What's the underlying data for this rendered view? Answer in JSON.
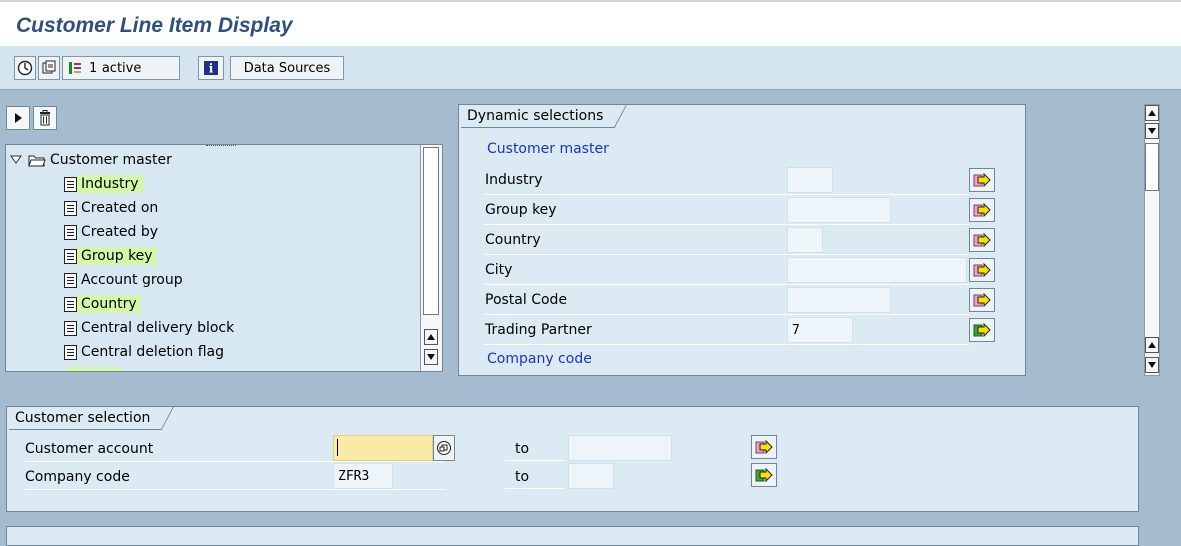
{
  "window": {
    "title": "Customer Line Item Display"
  },
  "toolbar": {
    "active_count": "1",
    "active_label": "active",
    "data_sources": "Data Sources"
  },
  "tree": {
    "root": "Customer master",
    "items": [
      {
        "label": "Industry",
        "highlight": true
      },
      {
        "label": "Created on",
        "highlight": false
      },
      {
        "label": "Created by",
        "highlight": false
      },
      {
        "label": "Group key",
        "highlight": true
      },
      {
        "label": "Account group",
        "highlight": false
      },
      {
        "label": "Country",
        "highlight": true
      },
      {
        "label": "Central delivery block",
        "highlight": false
      },
      {
        "label": "Central deletion flag",
        "highlight": false
      }
    ]
  },
  "dynamic": {
    "tab": "Dynamic selections",
    "section1": "Customer master",
    "rows": [
      {
        "label": "Industry",
        "value": ""
      },
      {
        "label": "Group key",
        "value": ""
      },
      {
        "label": "Country",
        "value": ""
      },
      {
        "label": "City",
        "value": ""
      },
      {
        "label": "Postal Code",
        "value": ""
      },
      {
        "label": "Trading Partner",
        "value": "7"
      }
    ],
    "section2": "Company code"
  },
  "customer": {
    "tab": "Customer selection",
    "rows": [
      {
        "label": "Customer account",
        "value": "",
        "to_label": "to",
        "to_value": ""
      },
      {
        "label": "Company code",
        "value": "ZFR3",
        "to_label": "to",
        "to_value": ""
      }
    ]
  },
  "colors": {
    "title": "#2f4f7f",
    "highlight": "#d4f7a8",
    "section": "#1a33c8",
    "required": "#fbe9a8"
  }
}
